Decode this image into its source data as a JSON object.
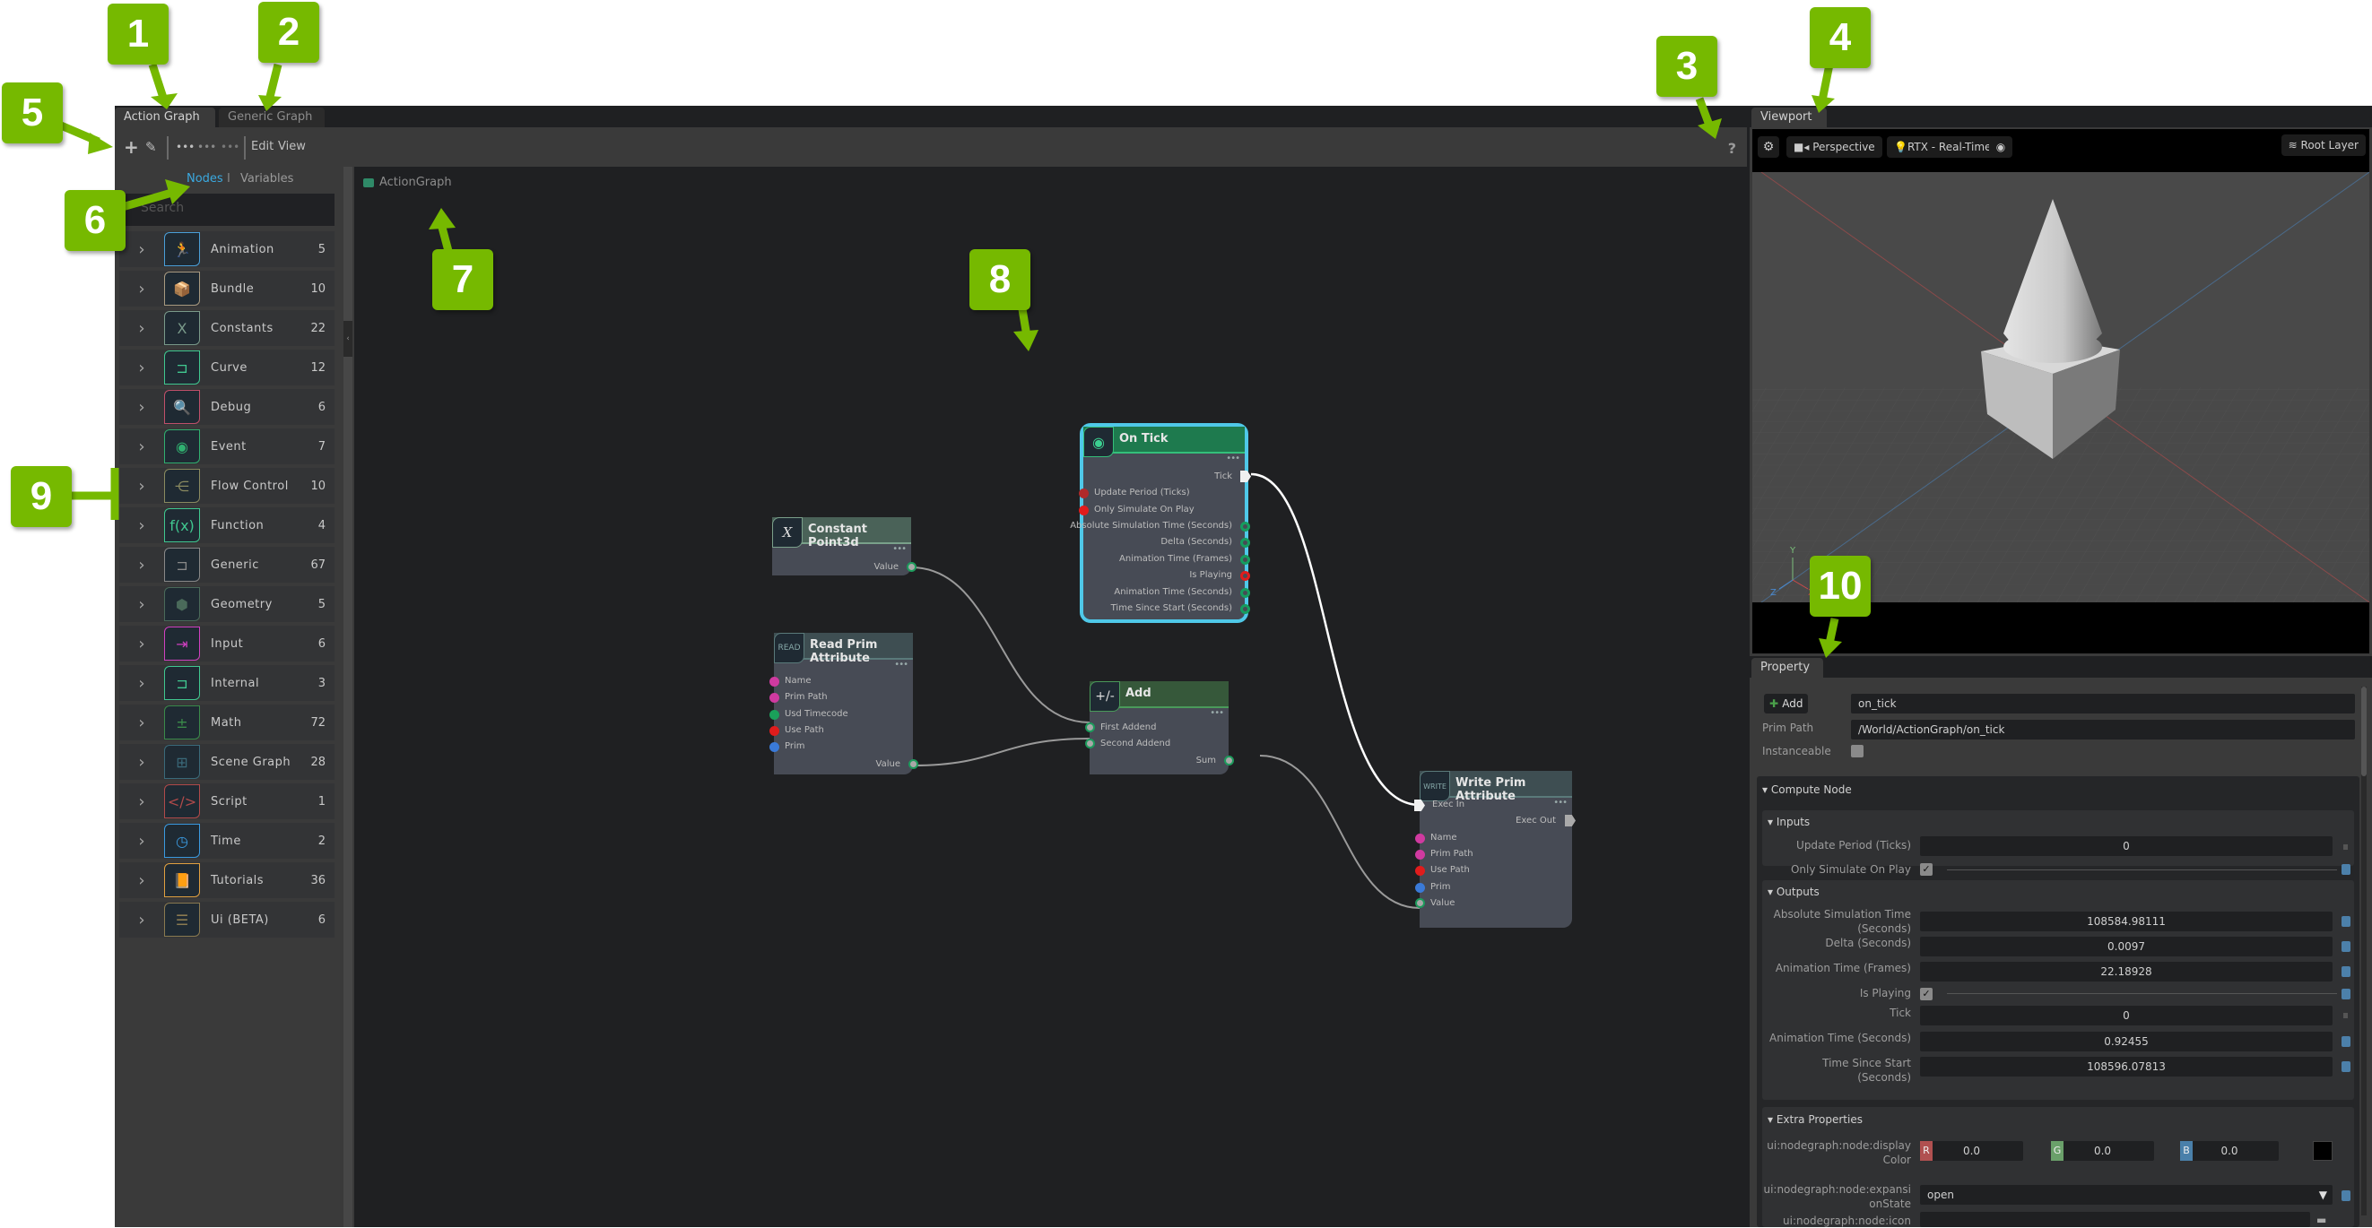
{
  "annotations": [
    "1",
    "2",
    "3",
    "4",
    "5",
    "6",
    "7",
    "8",
    "9",
    "10"
  ],
  "graph_panel": {
    "tabs": [
      {
        "label": "Action Graph",
        "active": true
      },
      {
        "label": "Generic Graph",
        "active": false
      }
    ],
    "toolbar": {
      "icons": [
        "plus-icon",
        "pencil-icon",
        "dots-icon",
        "dots-icon",
        "dots-icon"
      ],
      "menus": [
        "Edit",
        "View"
      ],
      "help": "?"
    },
    "library": {
      "tabs": [
        "Nodes",
        "Variables"
      ],
      "tab_separator": "I",
      "search_placeholder": "Search",
      "categories": [
        {
          "label": "Animation",
          "count": "5",
          "icon": "running-figure-icon",
          "color": "#4a9fd8",
          "glyph": "🏃"
        },
        {
          "label": "Bundle",
          "count": "10",
          "icon": "open-box-icon",
          "color": "#a89a80",
          "glyph": "📦"
        },
        {
          "label": "Constants",
          "count": "22",
          "icon": "x-variable-icon",
          "color": "#7a9a8a",
          "glyph": "X"
        },
        {
          "label": "Curve",
          "count": "12",
          "icon": "node-icon",
          "color": "#40c890",
          "glyph": "⊐"
        },
        {
          "label": "Debug",
          "count": "6",
          "icon": "bug-magnifier-icon",
          "color": "#c0506a",
          "glyph": "🔍"
        },
        {
          "label": "Event",
          "count": "7",
          "icon": "wifi-signal-icon",
          "color": "#30b070",
          "glyph": "◉"
        },
        {
          "label": "Flow Control",
          "count": "10",
          "icon": "branch-icon",
          "color": "#8a8a60",
          "glyph": "⋲"
        },
        {
          "label": "Function",
          "count": "4",
          "icon": "function-fx-icon",
          "color": "#40c890",
          "glyph": "f(x)"
        },
        {
          "label": "Generic",
          "count": "67",
          "icon": "node-icon",
          "color": "#888888",
          "glyph": "⊐"
        },
        {
          "label": "Geometry",
          "count": "5",
          "icon": "cube-icon",
          "color": "#4a6a5a",
          "glyph": "⬢"
        },
        {
          "label": "Input",
          "count": "6",
          "icon": "input-arrow-icon",
          "color": "#d040c0",
          "glyph": "⇥"
        },
        {
          "label": "Internal",
          "count": "3",
          "icon": "node-icon",
          "color": "#40c890",
          "glyph": "⊐"
        },
        {
          "label": "Math",
          "count": "72",
          "icon": "plus-minus-icon",
          "color": "#3a8a4a",
          "glyph": "±"
        },
        {
          "label": "Scene Graph",
          "count": "28",
          "icon": "hierarchy-icon",
          "color": "#3a6a7a",
          "glyph": "⊞"
        },
        {
          "label": "Script",
          "count": "1",
          "icon": "code-tag-icon",
          "color": "#b04a4a",
          "glyph": "</>"
        },
        {
          "label": "Time",
          "count": "2",
          "icon": "clock-icon",
          "color": "#3a9ae0",
          "glyph": "◷"
        },
        {
          "label": "Tutorials",
          "count": "36",
          "icon": "book-icon",
          "color": "#e0a040",
          "glyph": "📙"
        },
        {
          "label": "Ui (BETA)",
          "count": "6",
          "icon": "ui-layout-icon",
          "color": "#8a7a50",
          "glyph": "☰"
        }
      ]
    },
    "canvas": {
      "breadcrumb": "ActionGraph",
      "nodes": {
        "on_tick": {
          "title": "On Tick",
          "icon": "wifi-signal-icon",
          "outputs_exec": [
            "Tick"
          ],
          "inputs": [
            "Update Period (Ticks)",
            "Only Simulate On Play"
          ],
          "outputs": [
            "Absolute Simulation Time (Seconds)",
            "Delta (Seconds)",
            "Animation Time (Frames)",
            "Is Playing",
            "Animation Time (Seconds)",
            "Time Since Start (Seconds)"
          ]
        },
        "constant_point3d": {
          "title": "Constant Point3d",
          "icon_text": "X",
          "outputs": [
            "Value"
          ]
        },
        "read_prim_attribute": {
          "title": "Read Prim Attribute",
          "icon_text": "READ",
          "inputs": [
            "Name",
            "Prim Path",
            "Usd Timecode",
            "Use Path",
            "Prim"
          ],
          "outputs": [
            "Value"
          ]
        },
        "add": {
          "title": "Add",
          "icon_text": "+/-",
          "inputs": [
            "First Addend",
            "Second Addend"
          ],
          "outputs": [
            "Sum"
          ]
        },
        "write_prim_attribute": {
          "title": "Write Prim Attribute",
          "icon_text": "WRITE",
          "inputs_exec": [
            "Exec In"
          ],
          "outputs_exec": [
            "Exec Out"
          ],
          "inputs": [
            "Name",
            "Prim Path",
            "Use Path",
            "Prim",
            "Value"
          ]
        }
      }
    }
  },
  "viewport": {
    "tab": "Viewport",
    "buttons": {
      "settings": "gear-icon",
      "camera": "Perspective",
      "renderer": "RTX - Real-Time",
      "visibility": "eye-icon",
      "layer": "Root Layer"
    },
    "axes": [
      "Y",
      "Z",
      "X"
    ]
  },
  "property": {
    "tab": "Property",
    "add_label": "Add",
    "name_value": "on_tick",
    "prim_path_label": "Prim Path",
    "prim_path_value": "/World/ActionGraph/on_tick",
    "instanceable_label": "Instanceable",
    "compute_node_label": "Compute Node",
    "inputs_label": "Inputs",
    "inputs": [
      {
        "label": "Update Period (Ticks)",
        "value": "0"
      },
      {
        "label": "Only Simulate On Play",
        "checked": true
      }
    ],
    "outputs_label": "Outputs",
    "outputs": [
      {
        "label": "Absolute Simulation Time (Seconds)",
        "value": "108584.98111"
      },
      {
        "label": "Delta (Seconds)",
        "value": "0.0097"
      },
      {
        "label": "Animation Time (Frames)",
        "value": "22.18928"
      },
      {
        "label": "Is Playing",
        "checked": true
      },
      {
        "label": "Tick",
        "value": "0"
      },
      {
        "label": "Animation Time (Seconds)",
        "value": "0.92455"
      },
      {
        "label": "Time Since Start (Seconds)",
        "value": "108596.07813"
      }
    ],
    "extra_label": "Extra Properties",
    "extra": {
      "display_color_label": "ui:nodegraph:node:displayColor",
      "r_label": "R",
      "r": "0.0",
      "g_label": "G",
      "g": "0.0",
      "b_label": "B",
      "b": "0.0",
      "expansion_label": "ui:nodegraph:node:expansionState",
      "expansion_value": "open",
      "icon_label": "ui:nodegraph:node:icon"
    }
  }
}
